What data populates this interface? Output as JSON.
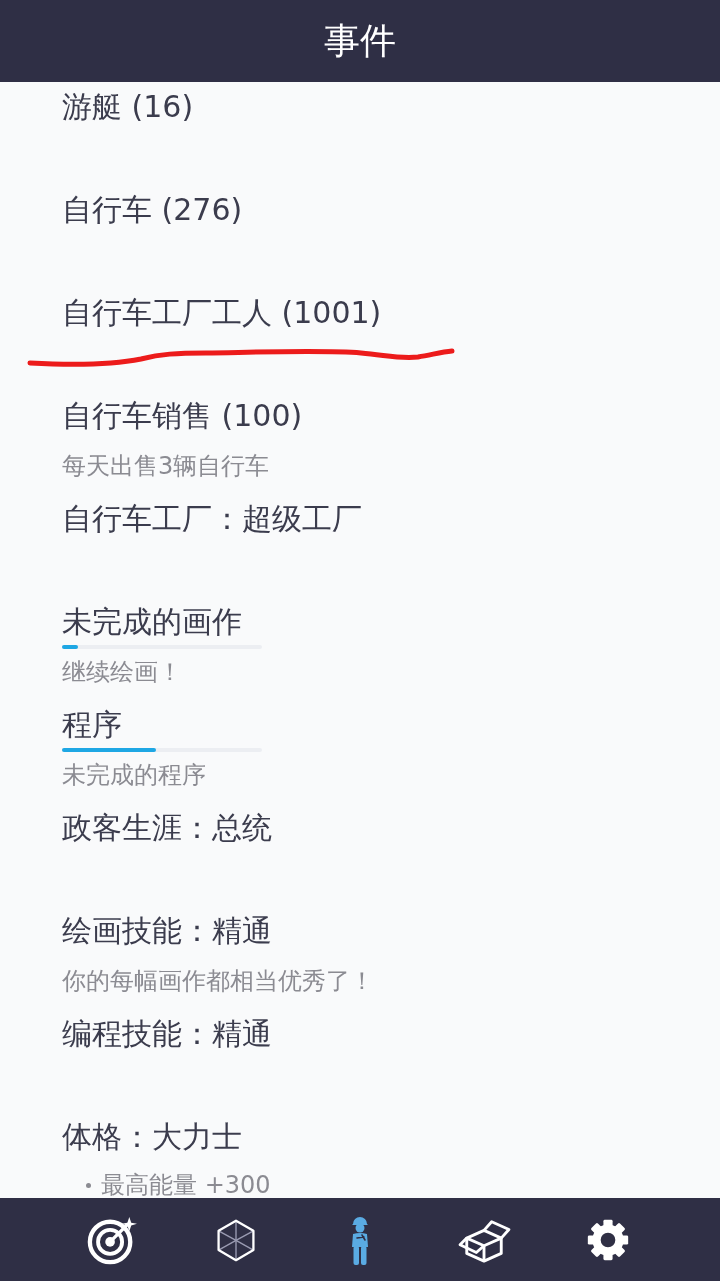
{
  "header": {
    "title": "事件"
  },
  "items": [
    {
      "title": "游艇 (16)",
      "underlined": false
    },
    {
      "title": "自行车 (276)",
      "underlined": false
    },
    {
      "title": "自行车工厂工人 (1001)",
      "underlined": true
    },
    {
      "title": "自行车销售 (100)",
      "subtitle": "每天出售3辆自行车",
      "underlined": false
    },
    {
      "title": "自行车工厂：超级工厂",
      "underlined": false
    },
    {
      "title": "未完成的画作",
      "level": 0.08,
      "subtitle": "继续绘画！",
      "underlined": false
    },
    {
      "title": "程序",
      "level": 0.47,
      "subtitle": "未完成的程序",
      "underlined": false
    },
    {
      "title": "政客生涯：总统",
      "underlined": false
    },
    {
      "title": "绘画技能：精通",
      "subtitle": "你的每幅画作都相当优秀了！",
      "underlined": false
    },
    {
      "title": "编程技能：精通",
      "underlined": false
    },
    {
      "title": "体格：大力士",
      "bullets": [
        "最高能量 +300"
      ],
      "underlined": false
    }
  ],
  "tabs": [
    {
      "selected": false
    },
    {
      "selected": false
    },
    {
      "selected": true
    },
    {
      "selected": false
    },
    {
      "selected": false
    }
  ]
}
